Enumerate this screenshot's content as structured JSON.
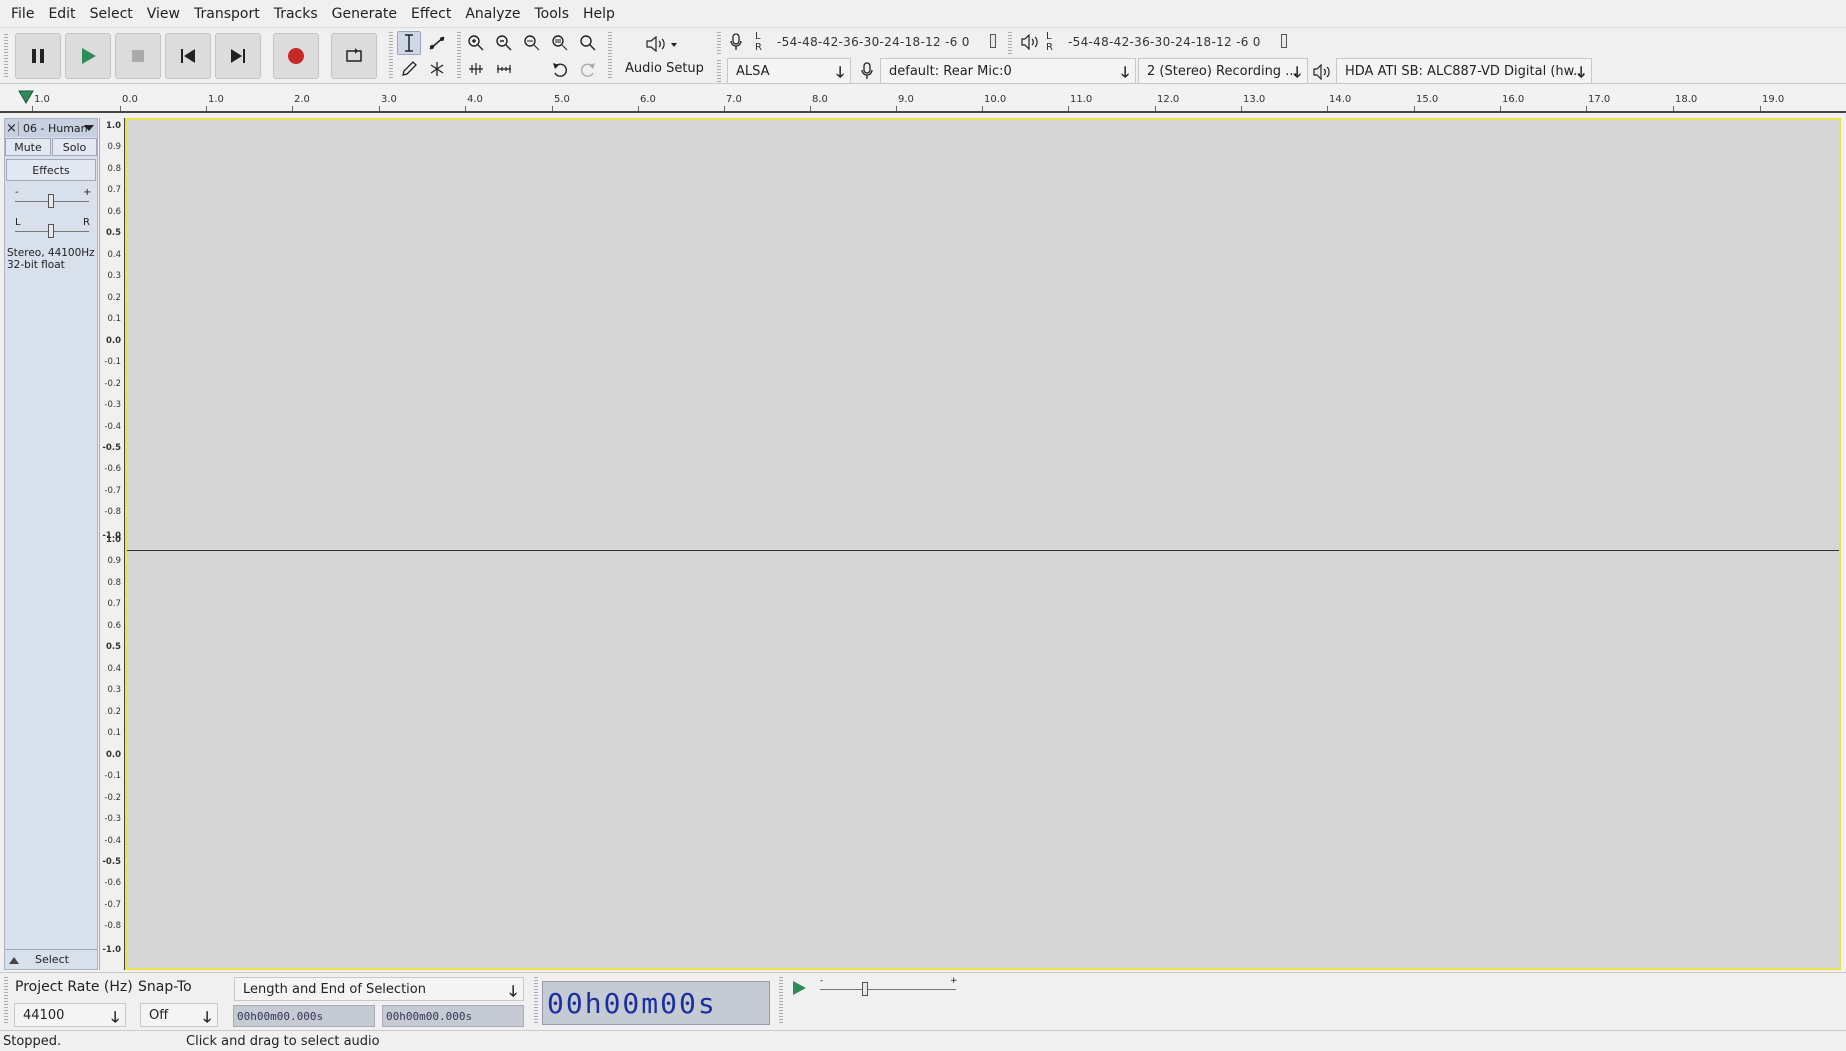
{
  "menu": [
    "File",
    "Edit",
    "Select",
    "View",
    "Transport",
    "Tracks",
    "Generate",
    "Effect",
    "Analyze",
    "Tools",
    "Help"
  ],
  "transport": {
    "pause": "pause-icon",
    "play": "play-icon",
    "stop": "stop-icon",
    "skip_start": "skip-to-start-icon",
    "skip_end": "skip-to-end-icon",
    "record": "record-icon",
    "loop": "loop-icon",
    "record_color": "#c62828",
    "play_color": "#2e8b57"
  },
  "audio_setup_label": "Audio Setup",
  "meters": {
    "record_scale": "-54-48-42-36-30-24-18-12 -6  0",
    "play_scale": "-54-48-42-36-30-24-18-12 -6  0",
    "l": "L",
    "r": "R"
  },
  "devices": {
    "host": "ALSA",
    "input": "default: Rear Mic:0",
    "channels": "2 (Stereo) Recording ...",
    "output": "HDA ATI SB: ALC887-VD Digital (hw..."
  },
  "timeline": {
    "ticks": [
      "1.0",
      "0.0",
      "1.0",
      "2.0",
      "3.0",
      "4.0",
      "5.0",
      "6.0",
      "7.0",
      "8.0",
      "9.0",
      "10.0",
      "11.0",
      "12.0",
      "13.0",
      "14.0",
      "15.0",
      "16.0",
      "17.0",
      "18.0",
      "19.0"
    ]
  },
  "track": {
    "close": "×",
    "name": "06 - Human",
    "mute": "Mute",
    "solo": "Solo",
    "effects": "Effects",
    "gain_minus": "-",
    "gain_plus": "+",
    "pan_l": "L",
    "pan_r": "R",
    "info_line1": "Stereo, 44100Hz",
    "info_line2": "32-bit float",
    "select": "Select"
  },
  "amplitude_ticks": [
    "1.0",
    "0.9",
    "0.8",
    "0.7",
    "0.6",
    "0.5",
    "0.4",
    "0.3",
    "0.2",
    "0.1",
    "0.0",
    "-0.1",
    "-0.2",
    "-0.3",
    "-0.4",
    "-0.5",
    "-0.6",
    "-0.7",
    "-0.8",
    "-1.0"
  ],
  "selection": {
    "project_rate_label": "Project Rate (Hz)",
    "project_rate_value": "44100",
    "snap_to_label": "Snap-To",
    "snap_to_value": "Off",
    "selection_mode": "Length and End of Selection",
    "start_time": "00h00m00.000s",
    "end_time": "00h00m00.000s",
    "big_time": "00h00m00s"
  },
  "status": {
    "state": "Stopped.",
    "hint": "Click and drag to select audio"
  }
}
